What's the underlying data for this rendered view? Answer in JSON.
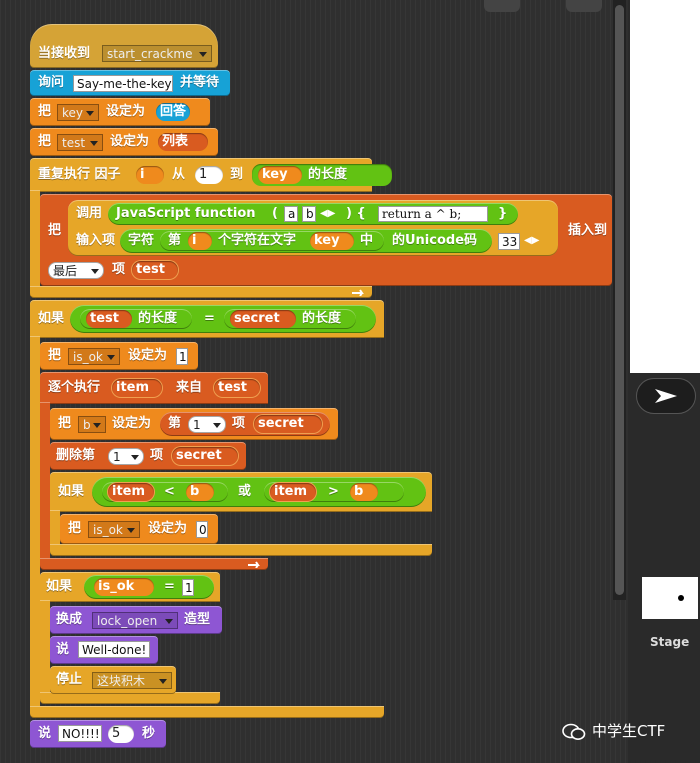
{
  "colors": {
    "event": "#d5a336",
    "sensing": "#17a2d6",
    "variables": "#ef8a1d",
    "lists": "#d95b20",
    "control": "#e6a628",
    "operators": "#62c213",
    "looks": "#8e56d3"
  },
  "blocks": {
    "when_receive": {
      "label": "当接收到",
      "message": "start_crackme"
    },
    "ask": {
      "label": "询问",
      "text": "Say-me-the-key",
      "suffix": "并等待"
    },
    "set_key": {
      "label": "把",
      "var": "key",
      "mid": "设定为",
      "value": "回答"
    },
    "set_test": {
      "label": "把",
      "var": "test",
      "mid": "设定为",
      "value": "列表"
    },
    "repeat_for": {
      "label": "重复执行 因子",
      "var": "i",
      "from": "从",
      "start": "1",
      "to": "到",
      "key": "key",
      "len": "的长度"
    },
    "insert": {
      "label": "把",
      "call": "调用",
      "func": "JavaScript function",
      "params_open": "(",
      "p1": "a",
      "p2": "b",
      "params_close": ") {",
      "code": "return a ^ b;",
      "brace": "}",
      "inputs_label": "输入项",
      "char_label": "字符",
      "ordinal": "第",
      "i": "i",
      "char_in_text": "个字符在文字",
      "key": "key",
      "in": "中",
      "unicode": "的Unicode码",
      "num": "33",
      "insert_to": "插入到",
      "position": "最后",
      "item": "项",
      "list": "test"
    },
    "if_len": {
      "label": "如果",
      "a": "test",
      "a_len": "的长度",
      "eq": "=",
      "b": "secret",
      "b_len": "的长度"
    },
    "set_is_ok1": {
      "label": "把",
      "var": "is_ok",
      "mid": "设定为",
      "value": "1"
    },
    "for_each": {
      "label": "逐个执行",
      "item": "item",
      "from": "来自",
      "list": "test"
    },
    "set_b": {
      "label": "把",
      "var": "b",
      "mid": "设定为",
      "ordinal": "第",
      "index": "1",
      "item": "项",
      "list": "secret"
    },
    "delete": {
      "label": "删除第",
      "index": "1",
      "item": "项",
      "list": "secret"
    },
    "if_cmp": {
      "label": "如果",
      "a": "item",
      "lt": "<",
      "b": "b",
      "or": "或",
      "c": "item",
      "gt": ">",
      "d": "b"
    },
    "set_is_ok0": {
      "label": "把",
      "var": "is_ok",
      "mid": "设定为",
      "value": "0"
    },
    "if_ok": {
      "label": "如果",
      "var": "is_ok",
      "eq": "=",
      "value": "1"
    },
    "switch_costume": {
      "label": "换成",
      "costume": "lock_open",
      "suffix": "造型"
    },
    "say": {
      "label": "说",
      "text": "Well-done!"
    },
    "stop": {
      "label": "停止",
      "target": "这块积木"
    },
    "say_for": {
      "label": "说",
      "text": "NO!!!!",
      "secs": "5",
      "unit": "秒"
    }
  },
  "stage": {
    "label": "Stage"
  },
  "watermark": "中学生CTF"
}
